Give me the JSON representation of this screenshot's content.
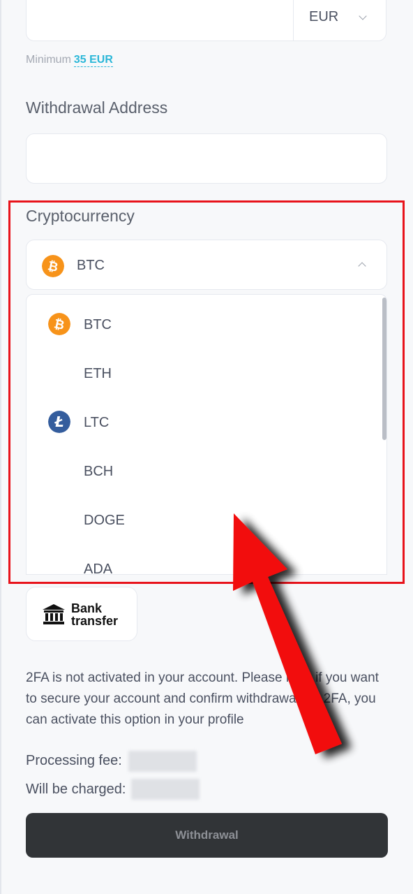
{
  "amount": {
    "currency": "EUR"
  },
  "minimum": {
    "label": "Minimum",
    "amount": "35 EUR"
  },
  "withdrawal_address": {
    "label": "Withdrawal Address",
    "value": ""
  },
  "cryptocurrency": {
    "label": "Cryptocurrency",
    "selected": "BTC",
    "options": [
      {
        "label": "BTC",
        "icon": "bitcoin-icon"
      },
      {
        "label": "ETH",
        "icon": ""
      },
      {
        "label": "LTC",
        "icon": "litecoin-icon"
      },
      {
        "label": "BCH",
        "icon": ""
      },
      {
        "label": "DOGE",
        "icon": ""
      },
      {
        "label": "ADA",
        "icon": ""
      }
    ]
  },
  "bank_transfer": {
    "label_line1": "Bank",
    "label_line2": "transfer"
  },
  "notice": "2FA is not activated in your account. Please note if you want to secure your account and confirm withdrawal via 2FA, you can activate this option in your profile",
  "fees": {
    "processing_label": "Processing fee:",
    "charged_label": "Will be charged:"
  },
  "withdraw_button": "Withdrawal",
  "colors": {
    "bitcoin": "#f7931a",
    "litecoin": "#345d9d",
    "highlight": "#e8131b",
    "link": "#2bb7d8"
  }
}
